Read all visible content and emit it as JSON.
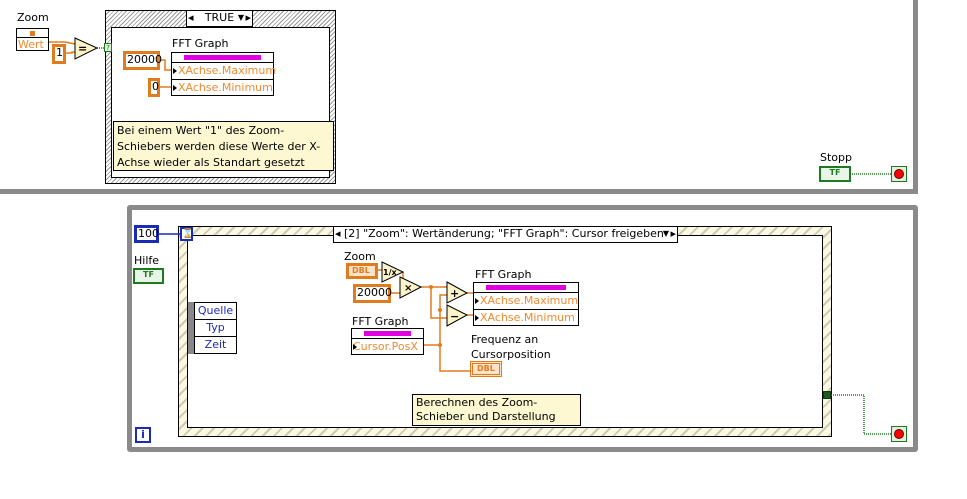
{
  "top_loop": {
    "zoom_control": {
      "label": "Zoom",
      "element": "Wert"
    },
    "const_one": "1",
    "equal_op": "=",
    "selector_terminal": "?",
    "case_selector": "TRUE",
    "fft_graph": {
      "label": "FFT Graph",
      "properties": [
        "XAchse.Maximum",
        "XAchse.Minimum"
      ]
    },
    "const_max": "20000",
    "const_min": "0",
    "comment": "Bei einem Wert \"1\" des Zoom-Schiebers werden diese Werte der X-Achse wieder als Standart gesetzt",
    "stop_label": "Stopp",
    "stop_tf": "TF"
  },
  "bottom_loop": {
    "timeout_const": "100",
    "help_label": "Hilfe",
    "help_tf": "TF",
    "event_selector": "[2] \"Zoom\": Wertänderung;  \"FFT Graph\": Cursor freigeben",
    "event_data": [
      "Quelle",
      "Typ",
      "Zeit"
    ],
    "zoom_label": "Zoom",
    "zoom_type": "DBL",
    "reciprocal_op": "1/x",
    "multiply_op": "×",
    "const_20000": "20000",
    "add_op": "+",
    "subtract_op": "−",
    "fft_graph_out": {
      "label": "FFT Graph",
      "properties": [
        "XAchse.Maximum",
        "XAchse.Minimum"
      ]
    },
    "fft_graph_in": {
      "label": "FFT Graph",
      "properties": [
        "Cursor.PosX"
      ]
    },
    "freq_label": "Frequenz an Cursorposition",
    "freq_type": "DBL",
    "comment": "Berechnen des Zoom-Schieber und Darstellung",
    "iteration": "i"
  },
  "colors": {
    "wire_double": "#e07b20",
    "wire_bool": "#1e7a1e",
    "wire_int": "#1a2bb8",
    "loop_border": "#8a8a8a",
    "property_bar": "#e000e0"
  }
}
